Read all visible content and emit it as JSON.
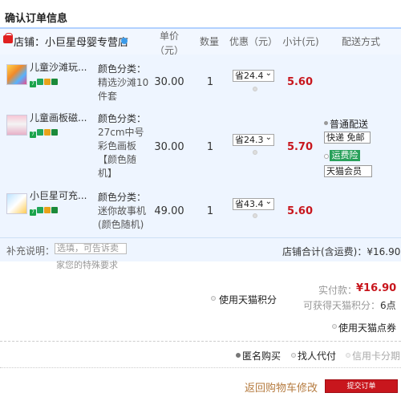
{
  "page": {
    "title": "确认订单信息"
  },
  "table_headers": {
    "unit_price_line1": "单价",
    "unit_price_line2": "（元）",
    "quantity": "数量",
    "discount": "优惠（元）",
    "subtotal": "小计(元)",
    "shipping": "配送方式"
  },
  "shop": {
    "label": "店铺：小巨星母婴专营店"
  },
  "items": [
    {
      "name": "儿童沙滩玩...",
      "spec_key": "颜色分类：",
      "spec_lines": [
        "精选沙滩10",
        "件套"
      ],
      "unit_price": "30.00",
      "quantity": "1",
      "discount": "省24.4",
      "subtotal": "5.60"
    },
    {
      "name": "儿童画板磁...",
      "spec_key": "颜色分类：",
      "spec_lines": [
        "27cm中号",
        "彩色画板",
        "【颜色随",
        "机】"
      ],
      "unit_price": "30.00",
      "quantity": "1",
      "discount": "省24.3",
      "subtotal": "5.70"
    },
    {
      "name": "小巨星可充...",
      "spec_key": "颜色分类：",
      "spec_lines": [
        "迷你故事机",
        "(颜色随机)"
      ],
      "unit_price": "49.00",
      "quantity": "1",
      "discount": "省43.4",
      "subtotal": "5.60"
    }
  ],
  "shipping": {
    "method_label": "普通配送",
    "express_select": "快递 免邮",
    "insurance_label": "运费险",
    "insurance_select": "天猫会员"
  },
  "note": {
    "label": "补充说明：",
    "placeholder": "选填，可告诉卖",
    "overflow": "家您的特殊要求"
  },
  "shop_total": "店铺合计(含运费)：¥16.90",
  "payment": {
    "tmall_points_label": "使用天猫积分",
    "actual_label": "实付款：",
    "actual_amount": "¥16.90",
    "points_earn_label": "可获得天猫积分：",
    "points_earn_value": "6点",
    "coupon_label": "使用天猫点券"
  },
  "options": {
    "anonymous": "匿名购买",
    "proxy_pay": "找人代付",
    "installment": "信用卡分期"
  },
  "actions": {
    "back_label": "返回购物车修改",
    "submit_label": "提交订单"
  },
  "colors": {
    "accent_red": "#c8161d",
    "header_border_blue": "#b2d1ff",
    "table_bg": "#eef5ff",
    "insurance_green": "#28a05a",
    "back_link_brown": "#b57b3f"
  }
}
